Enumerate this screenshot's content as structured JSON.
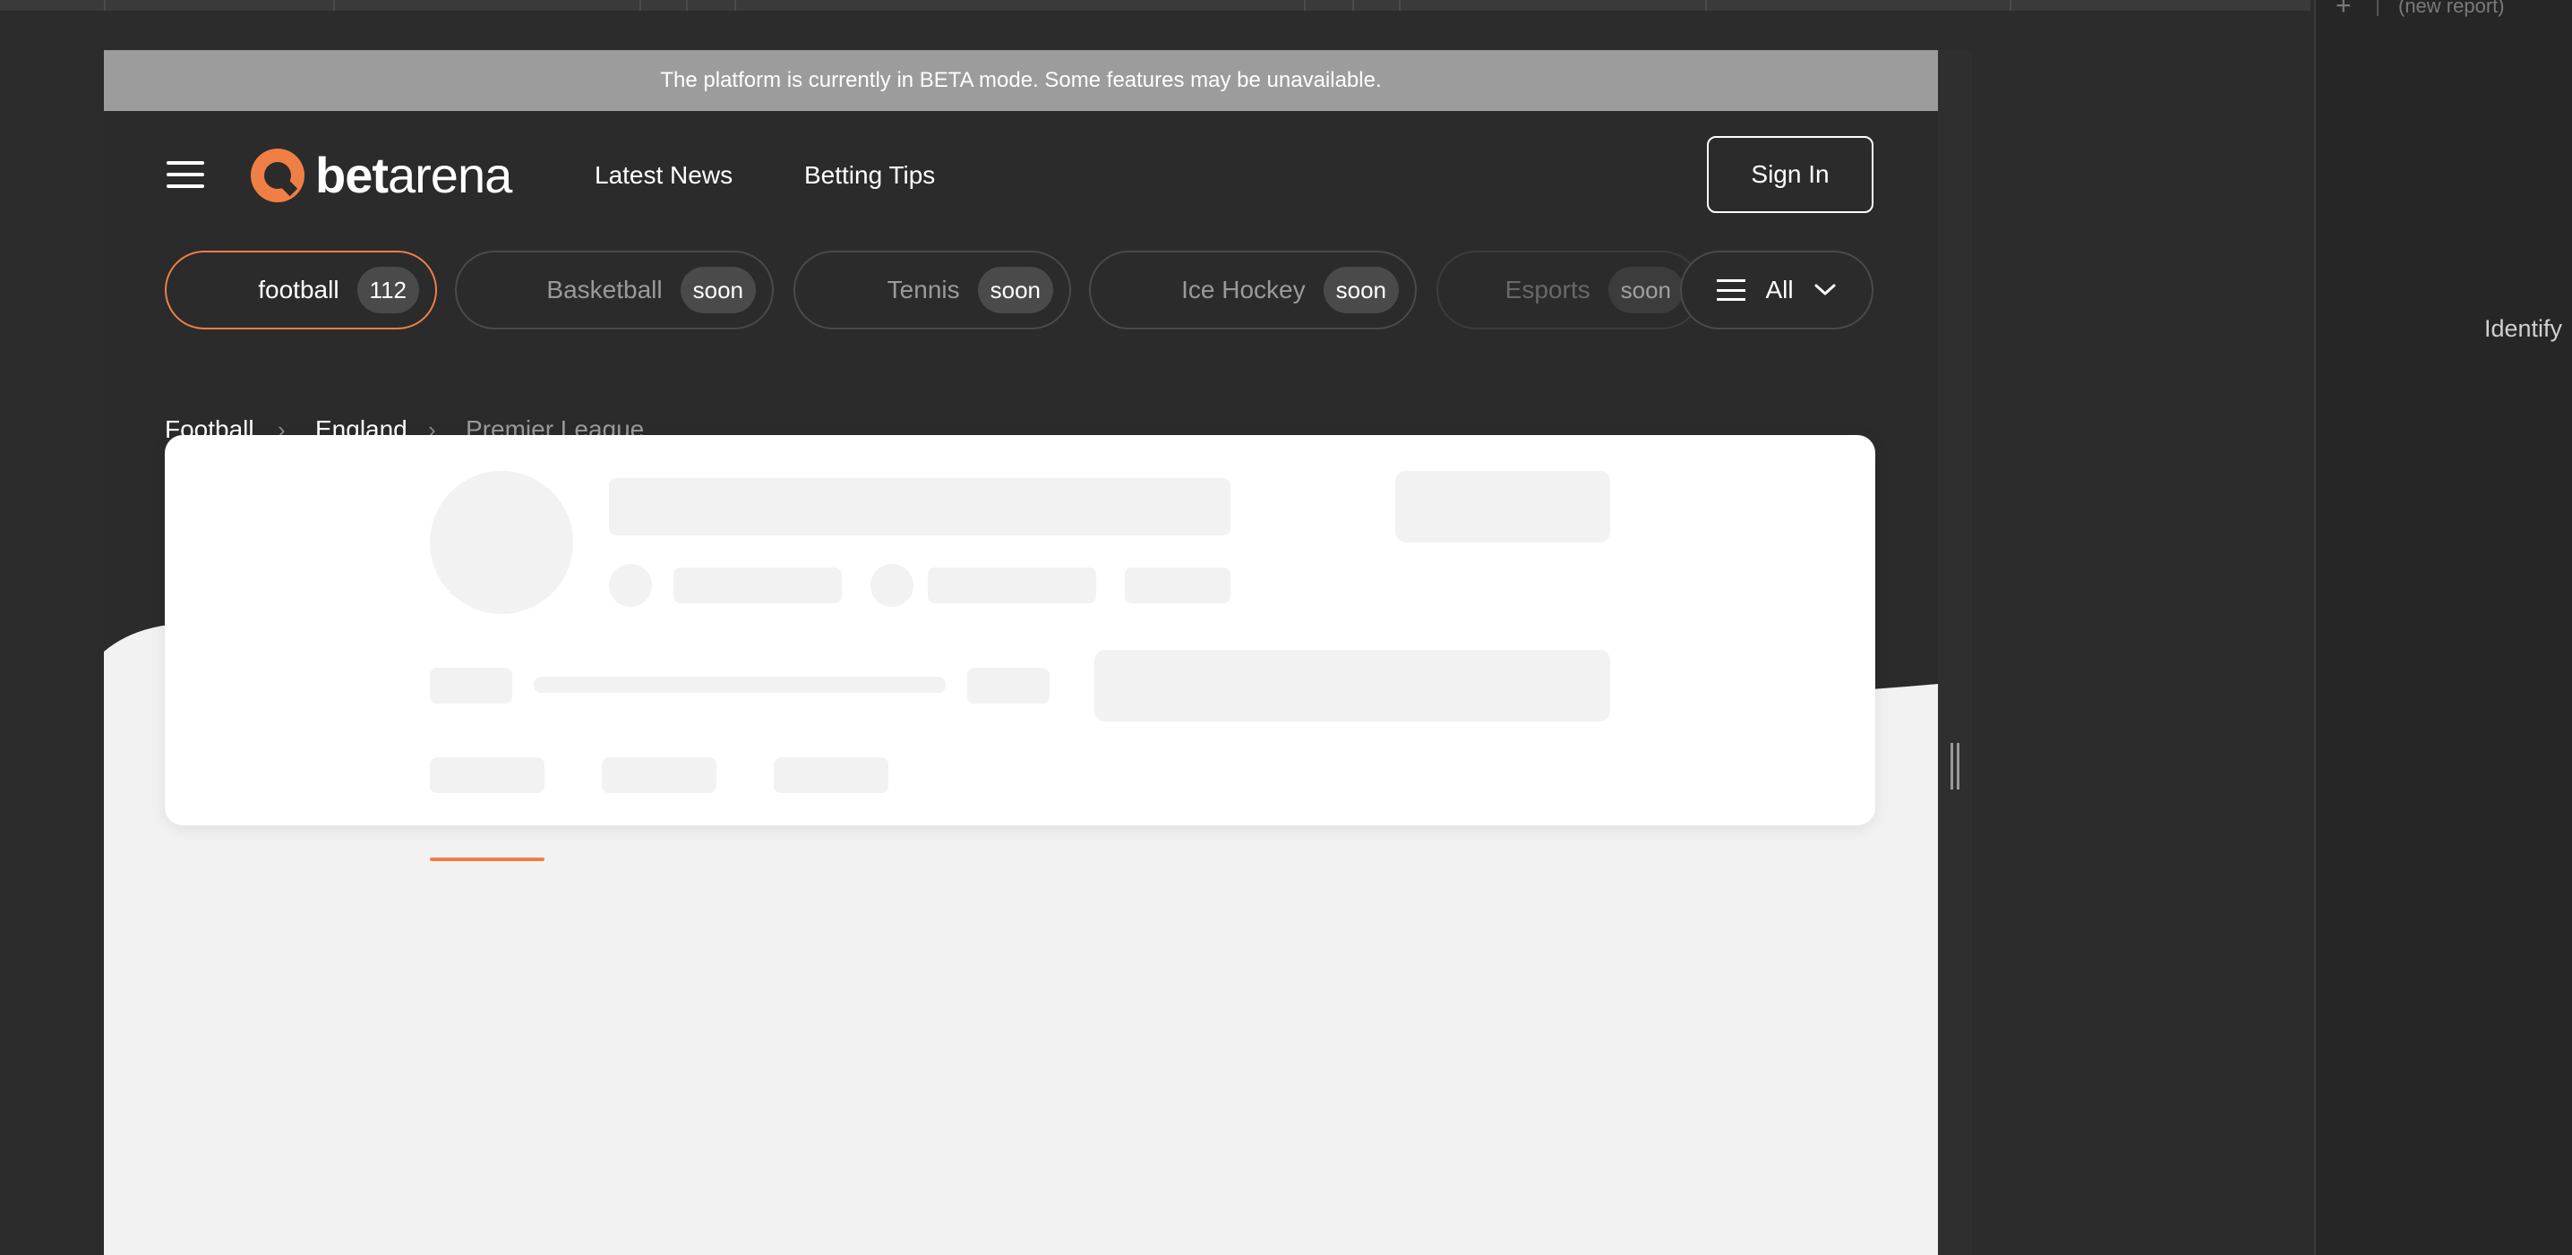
{
  "banner": {
    "text": "The platform is currently in BETA mode. Some features may be unavailable."
  },
  "header": {
    "logo": {
      "bold": "bet",
      "light": "arena"
    },
    "nav": [
      {
        "label": "Latest News"
      },
      {
        "label": "Betting Tips"
      }
    ],
    "sign_in_label": "Sign In"
  },
  "sports": [
    {
      "label": "football",
      "badge": "112",
      "active": true
    },
    {
      "label": "Basketball",
      "badge": "soon"
    },
    {
      "label": "Tennis",
      "badge": "soon"
    },
    {
      "label": "Ice Hockey",
      "badge": "soon"
    },
    {
      "label": "Esports",
      "badge": "soon"
    }
  ],
  "all_filter": {
    "label": "All"
  },
  "breadcrumb": [
    {
      "label": "Football"
    },
    {
      "label": "England"
    },
    {
      "label": "Premier League"
    }
  ],
  "side_panel": {
    "new_report": "(new report)",
    "identify": "Identify"
  },
  "colors": {
    "accent": "#f07f45",
    "dark_bg": "#2b2b2b",
    "beta_banner": "#9c9c9c",
    "page_bg": "#f2f2f2"
  }
}
